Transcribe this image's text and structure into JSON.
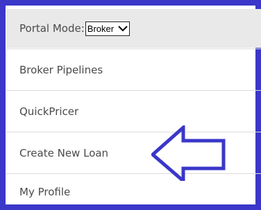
{
  "portal_mode": {
    "label": "Portal Mode:",
    "selected": "Broker",
    "chevron_icon": "chevron-down-icon"
  },
  "menu": {
    "items": [
      {
        "label": "Broker Pipelines"
      },
      {
        "label": "QuickPricer"
      },
      {
        "label": "Create New Loan"
      },
      {
        "label": "My Profile"
      }
    ]
  },
  "annotation": {
    "arrow_icon": "arrow-left-icon",
    "color": "#3a37c9"
  },
  "colors": {
    "frame_border": "#3a37c9",
    "header_bg": "#e9e9e9",
    "text": "#4a4a4a",
    "divider": "#dcdcdc"
  }
}
